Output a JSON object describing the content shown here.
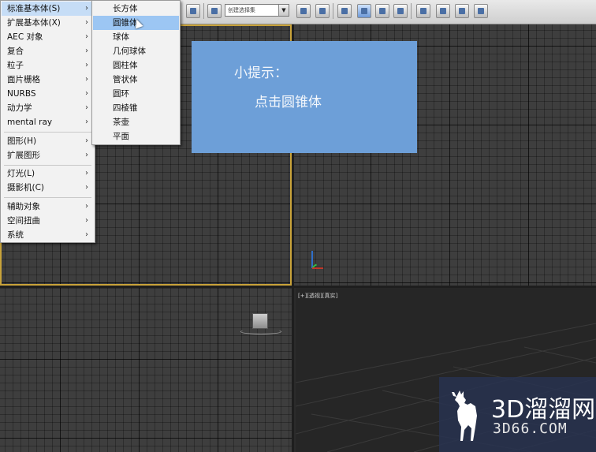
{
  "toolbar": {
    "selection_set_value": "创建选择集",
    "dropdown_arrow": "▼"
  },
  "main_menu": {
    "items": [
      {
        "label": "标准基本体(S)",
        "has_submenu": true,
        "highlighted": true
      },
      {
        "label": "扩展基本体(X)",
        "has_submenu": true
      },
      {
        "label": "AEC 对象",
        "has_submenu": true
      },
      {
        "label": "复合",
        "has_submenu": true
      },
      {
        "label": "粒子",
        "has_submenu": true
      },
      {
        "label": "面片栅格",
        "has_submenu": true
      },
      {
        "label": "NURBS",
        "has_submenu": true
      },
      {
        "label": "动力学",
        "has_submenu": true
      },
      {
        "label": "mental ray",
        "has_submenu": true
      },
      {
        "label": "图形(H)",
        "has_submenu": true
      },
      {
        "label": "扩展图形",
        "has_submenu": true
      },
      {
        "label": "灯光(L)",
        "has_submenu": true
      },
      {
        "label": "摄影机(C)",
        "has_submenu": true
      },
      {
        "label": "辅助对象",
        "has_submenu": true
      },
      {
        "label": "空间扭曲",
        "has_submenu": true
      },
      {
        "label": "系统",
        "has_submenu": true
      }
    ],
    "chevron": "›"
  },
  "sub_menu": {
    "items": [
      {
        "label": "长方体"
      },
      {
        "label": "圆锥体",
        "highlighted": true
      },
      {
        "label": "球体"
      },
      {
        "label": "几何球体"
      },
      {
        "label": "圆柱体"
      },
      {
        "label": "管状体"
      },
      {
        "label": "圆环"
      },
      {
        "label": "四棱锥"
      },
      {
        "label": "茶壶"
      },
      {
        "label": "平面"
      }
    ]
  },
  "hint": {
    "title": "小提示：",
    "body": "点击圆锥体"
  },
  "viewport": {
    "perspective_label": "[+][透视][真实]"
  },
  "watermark": {
    "name": "3D溜溜网",
    "url": "3D66.COM"
  },
  "colors": {
    "active_viewport_border": "#c9a33a",
    "hint_background": "#6d9fd8",
    "menu_highlight": "#9cc6f3"
  }
}
